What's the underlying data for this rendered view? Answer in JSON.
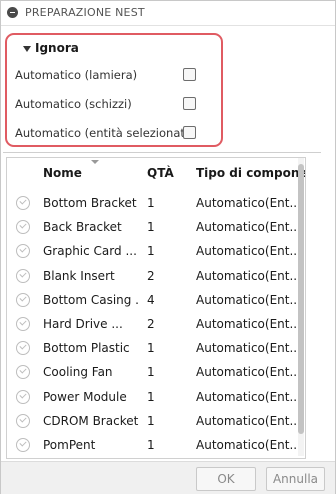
{
  "title": "PREPARAZIONE NEST",
  "ignore_section": {
    "title": "Ignora",
    "options": [
      {
        "label": "Automatico (lamiera)",
        "checked": false
      },
      {
        "label": "Automatico (schizzi)",
        "checked": false
      },
      {
        "label": "Automatico (entità selezionate)",
        "checked": false
      }
    ]
  },
  "table": {
    "columns": [
      "Nome",
      "QTÀ",
      "Tipo di componen"
    ],
    "rows": [
      {
        "name": "Bottom Bracket",
        "qty": "1",
        "type": "Automatico(Ent..."
      },
      {
        "name": "Back Bracket",
        "qty": "1",
        "type": "Automatico(Ent..."
      },
      {
        "name": "Graphic Card ...",
        "qty": "1",
        "type": "Automatico(Ent..."
      },
      {
        "name": "Blank Insert",
        "qty": "2",
        "type": "Automatico(Ent..."
      },
      {
        "name": "Bottom Casing ...",
        "qty": "4",
        "type": "Automatico(Ent..."
      },
      {
        "name": "Hard Drive ...",
        "qty": "2",
        "type": "Automatico(Ent..."
      },
      {
        "name": "Bottom Plastic",
        "qty": "1",
        "type": "Automatico(Ent..."
      },
      {
        "name": "Cooling Fan",
        "qty": "1",
        "type": "Automatico(Ent..."
      },
      {
        "name": "Power Module",
        "qty": "1",
        "type": "Automatico(Ent..."
      },
      {
        "name": "CDROM Bracket ...",
        "qty": "1",
        "type": "Automatico(Ent..."
      },
      {
        "name": "PomPent",
        "qty": "1",
        "type": "Automatico(Ent..."
      }
    ]
  },
  "footer": {
    "ok_label": "OK",
    "cancel_label": "Annulla"
  },
  "colors": {
    "highlight": "#e05b62",
    "disabled_text": "#8a8a8a"
  },
  "icons": {
    "title": "collapse-circle-icon",
    "section": "triangle-down-icon",
    "row": "check-circle-icon"
  }
}
